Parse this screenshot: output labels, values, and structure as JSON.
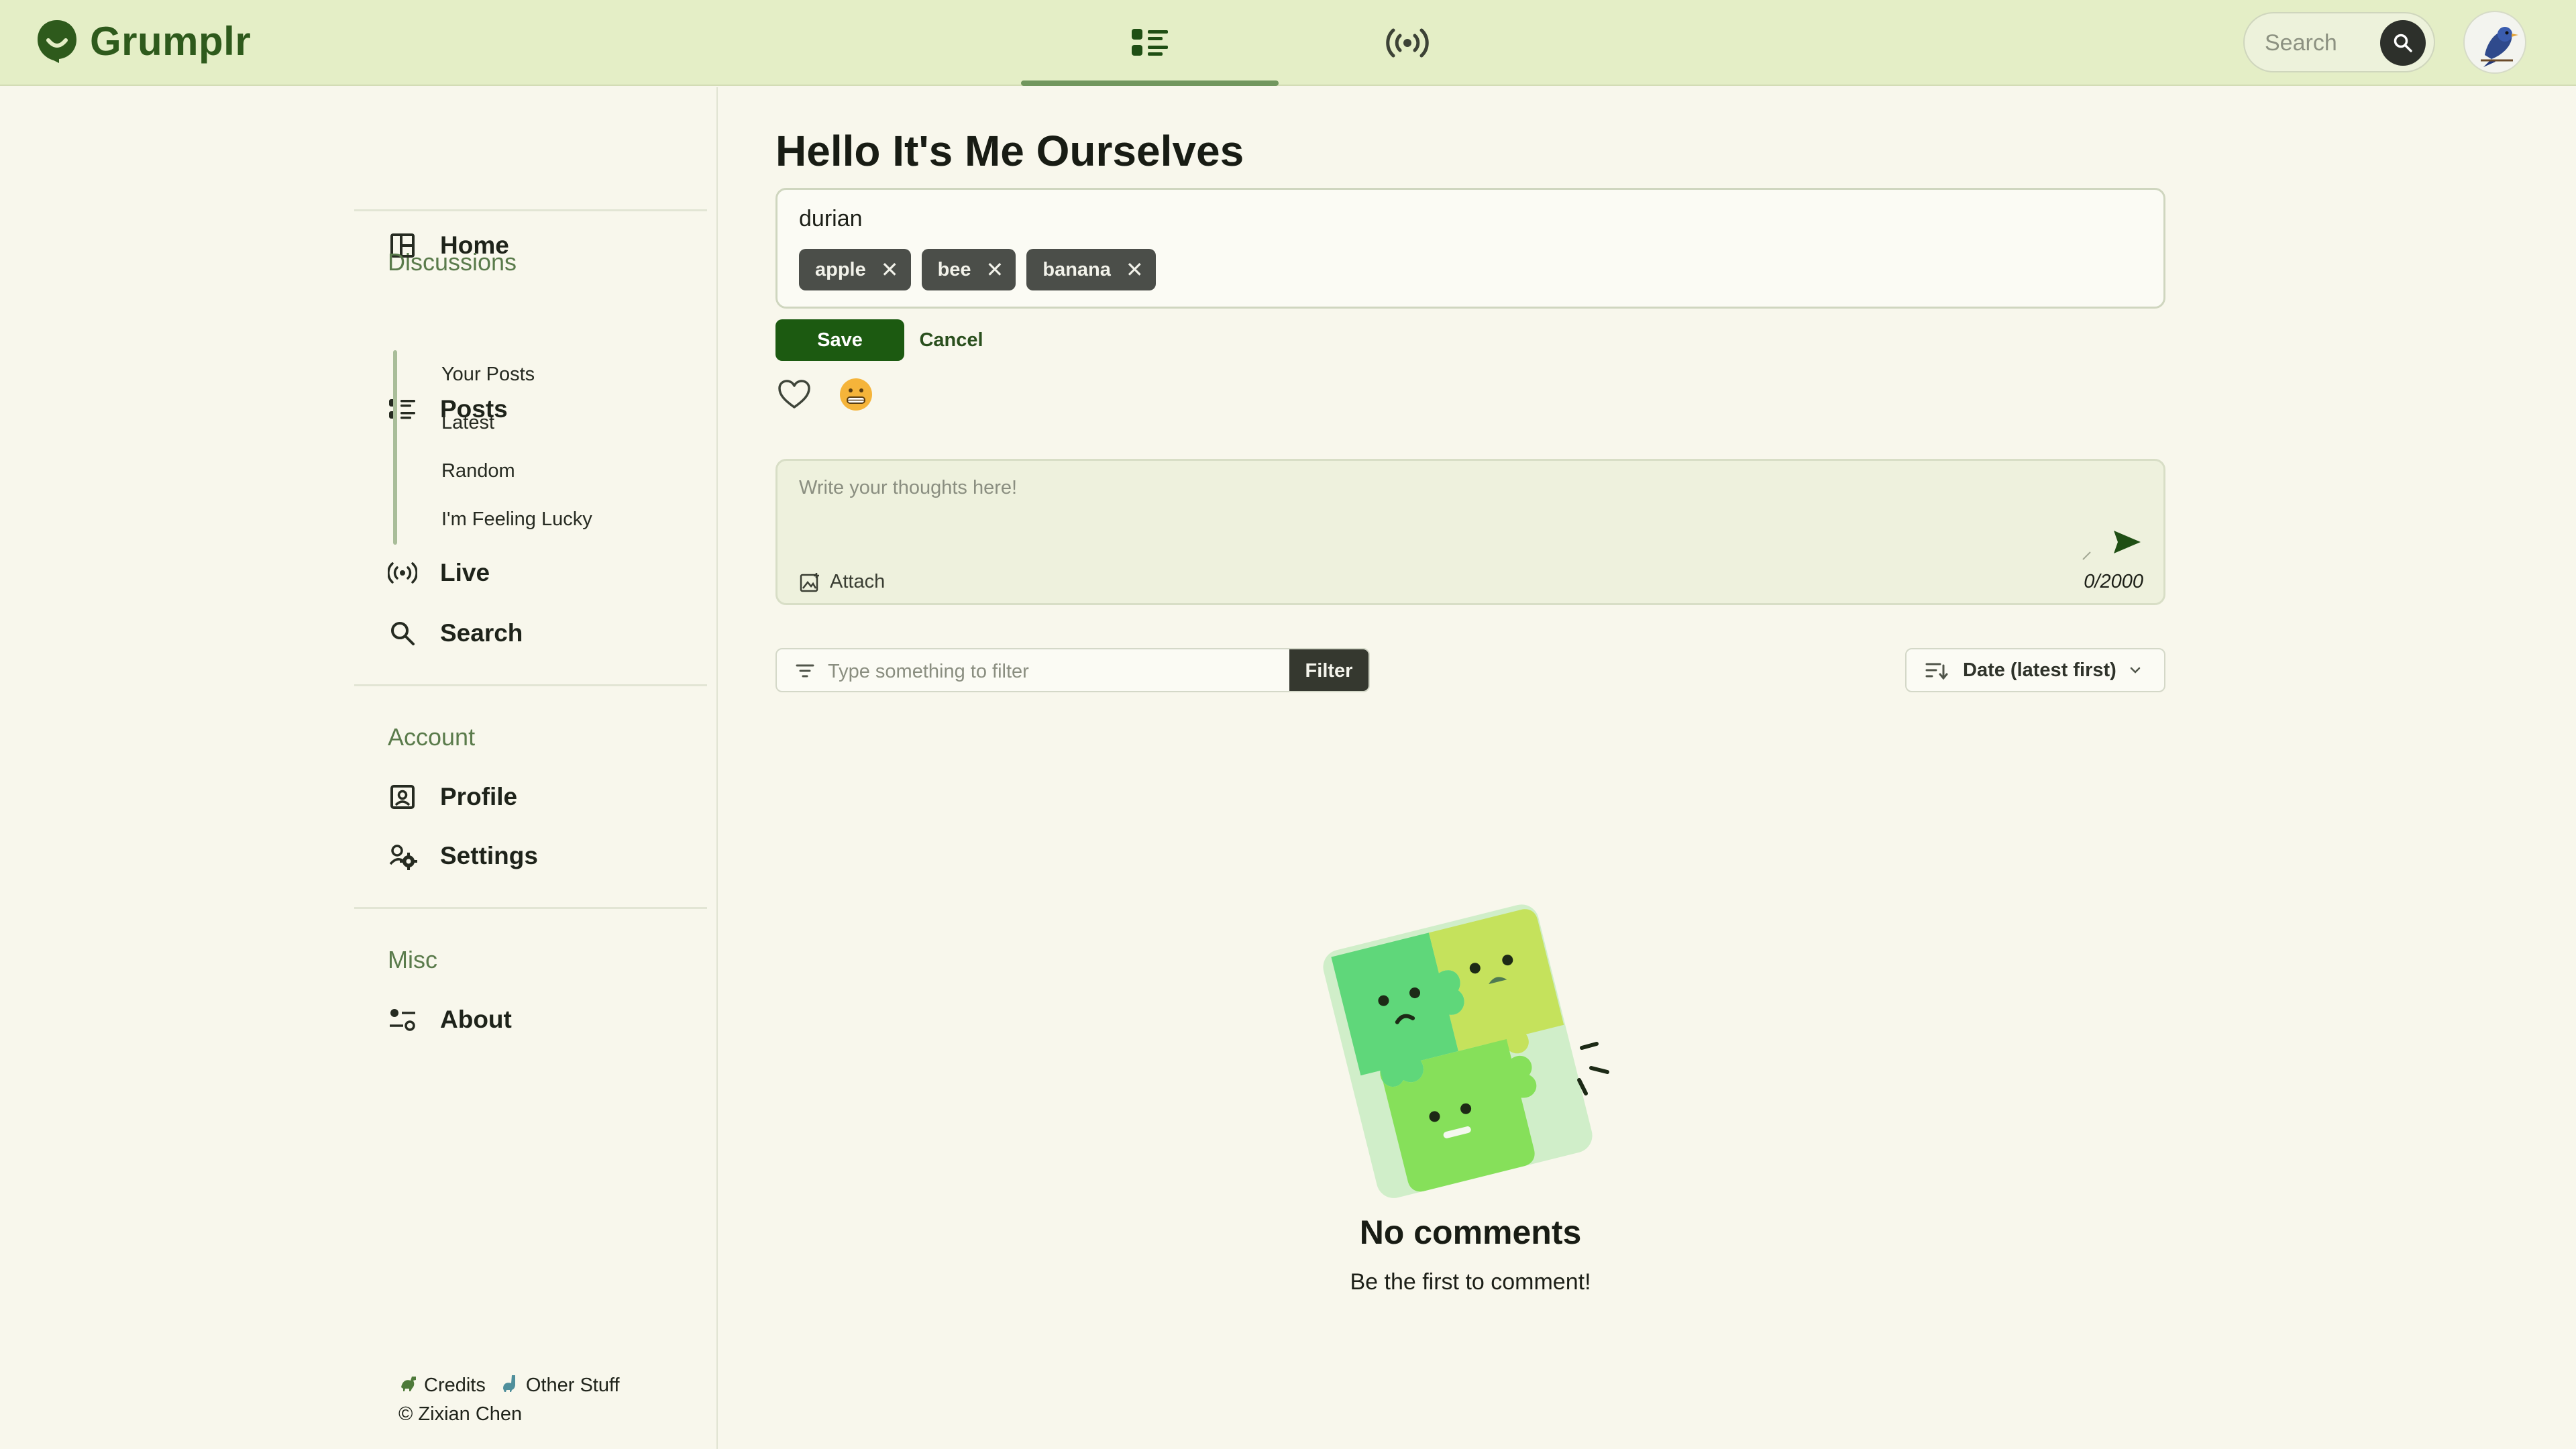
{
  "app": {
    "name": "Grumplr"
  },
  "header": {
    "tabs": [
      {
        "icon": "posts-list-icon",
        "active": true
      },
      {
        "icon": "live-broadcast-icon",
        "active": false
      }
    ],
    "search": {
      "placeholder": "Search"
    }
  },
  "sidebar": {
    "home_label": "Home",
    "discussions_heading": "Discussions",
    "posts_label": "Posts",
    "sub_items": [
      "Your Posts",
      "Latest",
      "Random",
      "I'm Feeling Lucky"
    ],
    "live_label": "Live",
    "search_label": "Search",
    "account_heading": "Account",
    "profile_label": "Profile",
    "settings_label": "Settings",
    "misc_heading": "Misc",
    "about_label": "About",
    "footer": {
      "credits": "Credits",
      "other": "Other Stuff",
      "copyright": "© Zixian Chen"
    }
  },
  "post": {
    "title": "Hello It's Me Ourselves",
    "edit_value": "durian",
    "tags": [
      "apple",
      "bee",
      "banana"
    ],
    "tag_remove_glyph": "✕",
    "save_label": "Save",
    "cancel_label": "Cancel"
  },
  "composer": {
    "placeholder": "Write your thoughts here!",
    "attach_label": "Attach",
    "char_count": "0/2000"
  },
  "filter": {
    "placeholder": "Type something to filter",
    "button_label": "Filter",
    "sort_label": "Date (latest first)"
  },
  "empty_state": {
    "title": "No comments",
    "subtitle": "Be the first to comment!"
  },
  "colors": {
    "header_bg": "#e4eec6",
    "page_bg": "#f8f7ec",
    "brand_green": "#2e5a1c",
    "save_green": "#1c5a11",
    "tab_indicator": "#72975e",
    "chip_bg": "#4b4e49"
  }
}
